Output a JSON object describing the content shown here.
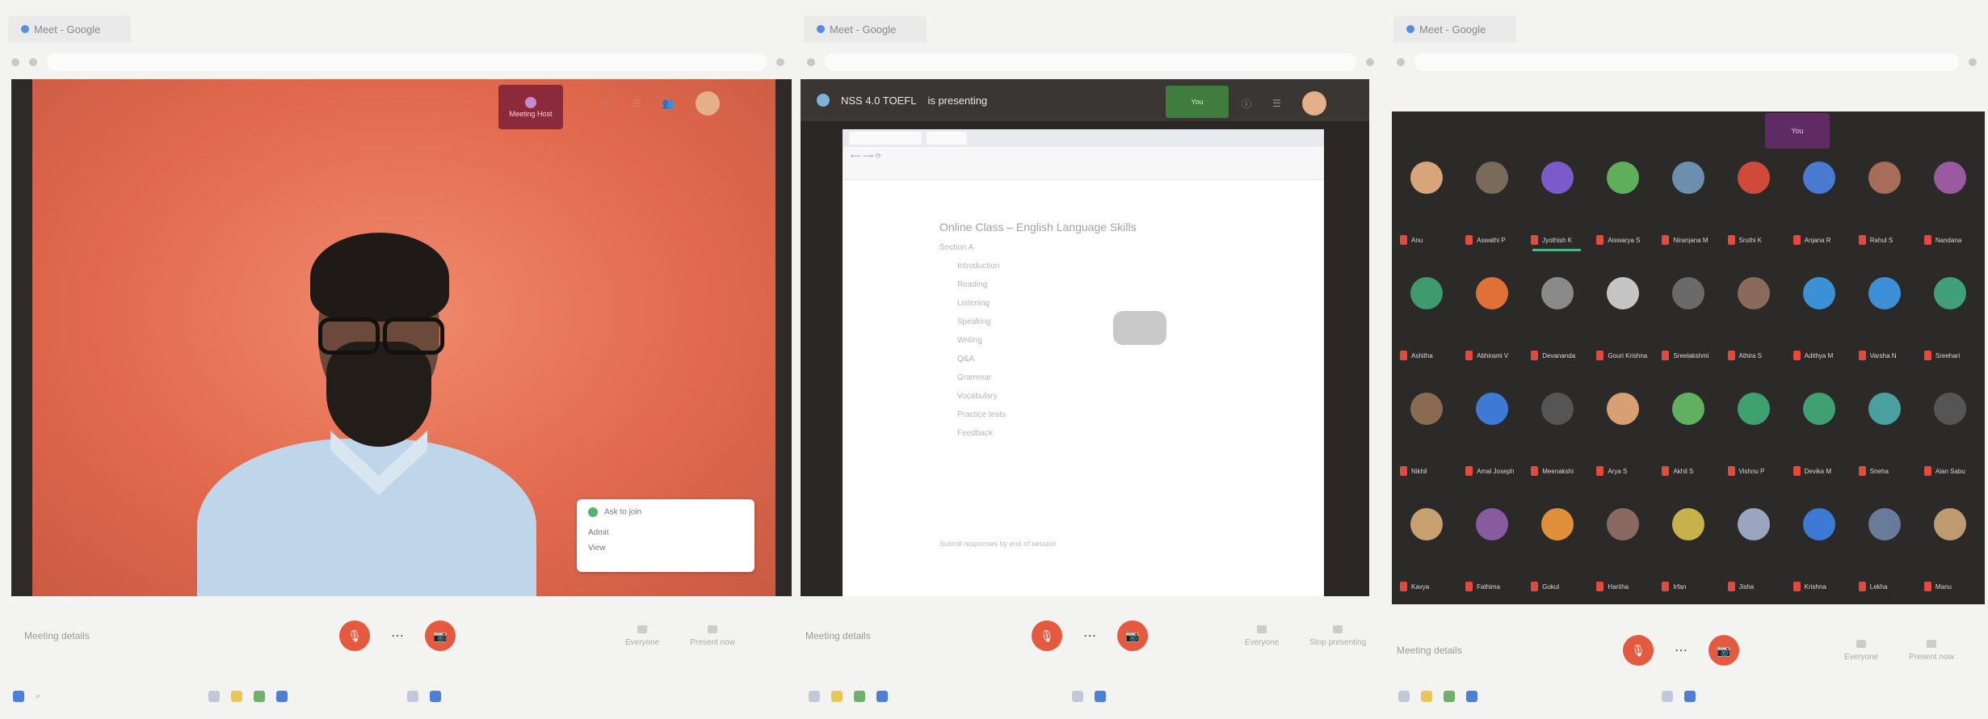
{
  "panels": [
    {
      "tab_title": "Meet - Google",
      "participant_tile": "Meeting Host",
      "notification": {
        "title": "Ask to join",
        "line1": "Admit",
        "line2": "View"
      },
      "meeting_label": "Meeting details",
      "controls": {
        "mic": "mic",
        "cam": "cam",
        "people": "Everyone",
        "present": "Present now"
      }
    },
    {
      "tab_title": "Meet - Google",
      "presenting_title": "NSS 4.0 TOEFL",
      "presenting_subtitle": "is presenting",
      "own_tile": "You",
      "doc": {
        "title": "Online Class – English Language Skills",
        "subtitle": "Section A",
        "lines": [
          "Introduction",
          "Reading",
          "Listening",
          "Speaking",
          "Writing",
          "Q&A",
          "Grammar",
          "Vocabulary",
          "Practice tests",
          "Feedback"
        ],
        "footer": "Submit responses by end of session"
      },
      "meeting_label": "Meeting details",
      "controls": {
        "people": "Everyone",
        "present": "Stop presenting"
      }
    },
    {
      "tab_title": "Meet - Google",
      "own_tile": "You",
      "meeting_label": "Meeting details",
      "controls": {
        "people": "Everyone",
        "present": "Present now"
      },
      "participants": [
        "Anu",
        "Aswathi P",
        "Jyothish K",
        "Aiswarya S",
        "Niranjana M",
        "Sruthi K",
        "Anjana R",
        "Rahul S",
        "Nandana",
        "Ashitha",
        "Abhirami V",
        "Devananda",
        "Gouri Krishna",
        "Sreelakshmi",
        "Athira S",
        "Adithya M",
        "Varsha N",
        "Sreehari",
        "Nikhil",
        "Amal Joseph",
        "Meenakshi",
        "Arya S",
        "Akhil S",
        "Vishnu P",
        "Devika M",
        "Sneha",
        "Alan Sabu",
        "Kavya",
        "Fathima",
        "Gokul",
        "Haritha",
        "Irfan",
        "Jisha",
        "Krishna",
        "Lekha",
        "Manu"
      ]
    }
  ]
}
